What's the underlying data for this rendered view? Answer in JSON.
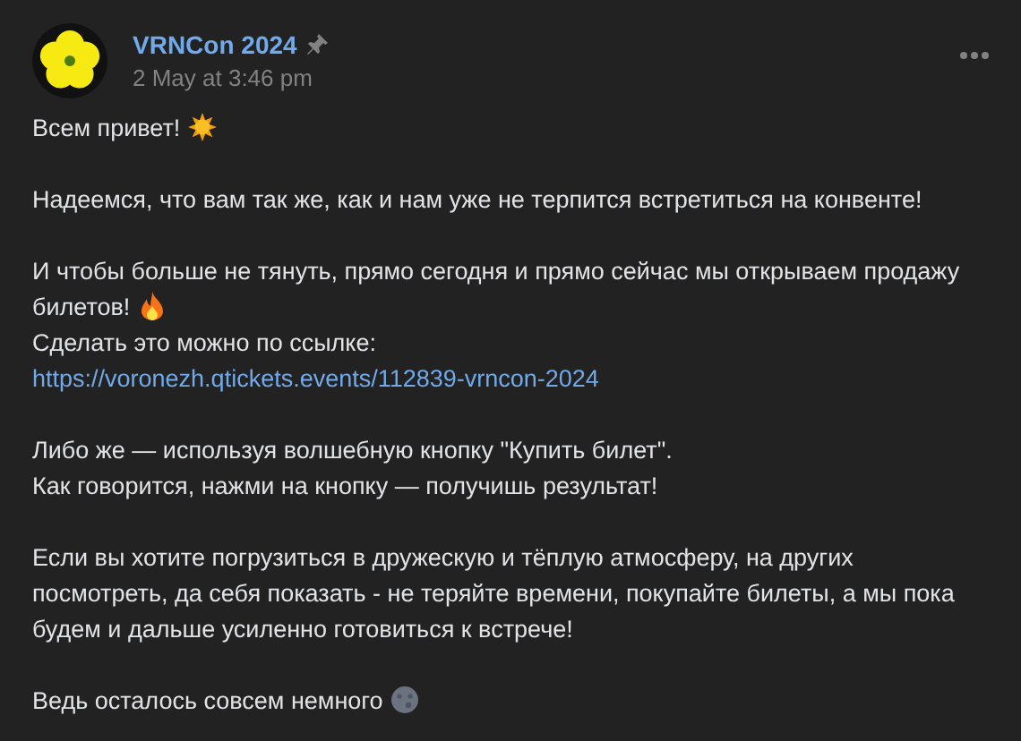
{
  "post": {
    "author": "VRNCon 2024",
    "pinned": true,
    "date": "2 May at 3:46 pm"
  },
  "paragraphs": [
    [
      {
        "kind": "text",
        "text": "Всем привет!",
        "icons": [
          {
            "kind": "sun"
          }
        ]
      }
    ],
    [
      {
        "kind": "text",
        "text": "Надеемся, что вам так же, как и нам уже не терпится встретиться на конвенте!"
      }
    ],
    [
      {
        "kind": "text",
        "text": "И чтобы больше не тянуть, прямо сегодня и прямо сейчас мы открываем продажу билетов!",
        "icons": [
          {
            "kind": "fire"
          }
        ]
      },
      {
        "kind": "text",
        "text": "Сделать это можно по ссылке:"
      },
      {
        "kind": "link",
        "text": "https://voronezh.qtickets.events/112839-vrncon-2024"
      }
    ],
    [
      {
        "kind": "text",
        "text": "Либо же — используя волшебную кнопку \"Купить билет\"."
      },
      {
        "kind": "text",
        "text": "Как говорится, нажми на кнопку — получишь результат!"
      }
    ],
    [
      {
        "kind": "text",
        "text": "Если вы хотите погрузиться в дружескую и тёплую атмосферу, на других посмотреть, да себя показать - не теряйте времени, покупайте билеты, а мы пока будем и дальше усиленно готовиться к встрече!"
      }
    ],
    [
      {
        "kind": "text",
        "text": "Ведь осталось совсем немного",
        "icons": [
          {
            "kind": "moon"
          }
        ]
      }
    ]
  ]
}
